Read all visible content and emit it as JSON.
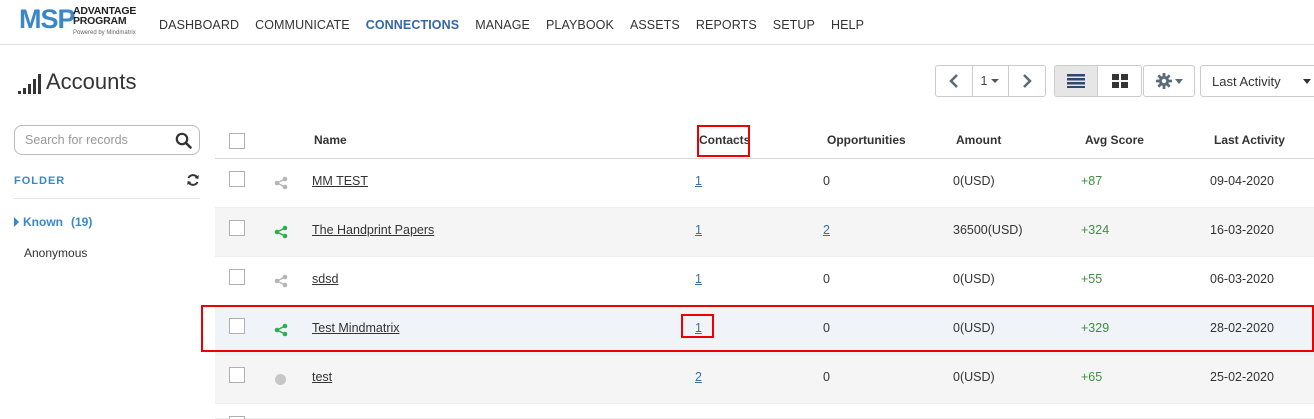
{
  "logo": {
    "brand": "MSP",
    "line1": "ADVANTAGE",
    "line2": "PROGRAM",
    "powered": "Powered by Mindmatrix"
  },
  "nav": [
    "DASHBOARD",
    "COMMUNICATE",
    "CONNECTIONS",
    "MANAGE",
    "PLAYBOOK",
    "ASSETS",
    "REPORTS",
    "SETUP",
    "HELP"
  ],
  "nav_active": "CONNECTIONS",
  "page": {
    "title": "Accounts"
  },
  "pager": {
    "page": "1"
  },
  "sort": {
    "label": "Last Activity"
  },
  "search": {
    "placeholder": "Search for records"
  },
  "sidebar": {
    "folder_label": "FOLDER",
    "known_label": "Known",
    "known_count": "(19)",
    "anonymous_label": "Anonymous"
  },
  "table": {
    "headers": {
      "name": "Name",
      "contacts": "Contacts",
      "opportunities": "Opportunities",
      "amount": "Amount",
      "avg_score": "Avg Score",
      "last_activity": "Last Activity"
    },
    "rows": [
      {
        "name": "MM TEST",
        "contacts": "1",
        "opportunities": "0",
        "amount": "0(USD)",
        "score": "+87",
        "last_activity": "09-04-2020",
        "share": "grey"
      },
      {
        "name": "The Handprint Papers",
        "contacts": "1",
        "opportunities": "2",
        "amount": "36500(USD)",
        "score": "+324",
        "last_activity": "16-03-2020",
        "share": "green"
      },
      {
        "name": "sdsd",
        "contacts": "1",
        "opportunities": "0",
        "amount": "0(USD)",
        "score": "+55",
        "last_activity": "06-03-2020",
        "share": "grey"
      },
      {
        "name": "Test Mindmatrix",
        "contacts": "1",
        "opportunities": "0",
        "amount": "0(USD)",
        "score": "+329",
        "last_activity": "28-02-2020",
        "share": "green"
      },
      {
        "name": "test",
        "contacts": "2",
        "opportunities": "0",
        "amount": "0(USD)",
        "score": "+65",
        "last_activity": "25-02-2020",
        "share": "dot"
      }
    ]
  },
  "colors": {
    "brand_blue": "#3a87c8",
    "share_green": "#2eae4e",
    "share_grey": "#b5b5b5",
    "highlight_red": "#e00000",
    "score_green": "#3f8f3f"
  }
}
